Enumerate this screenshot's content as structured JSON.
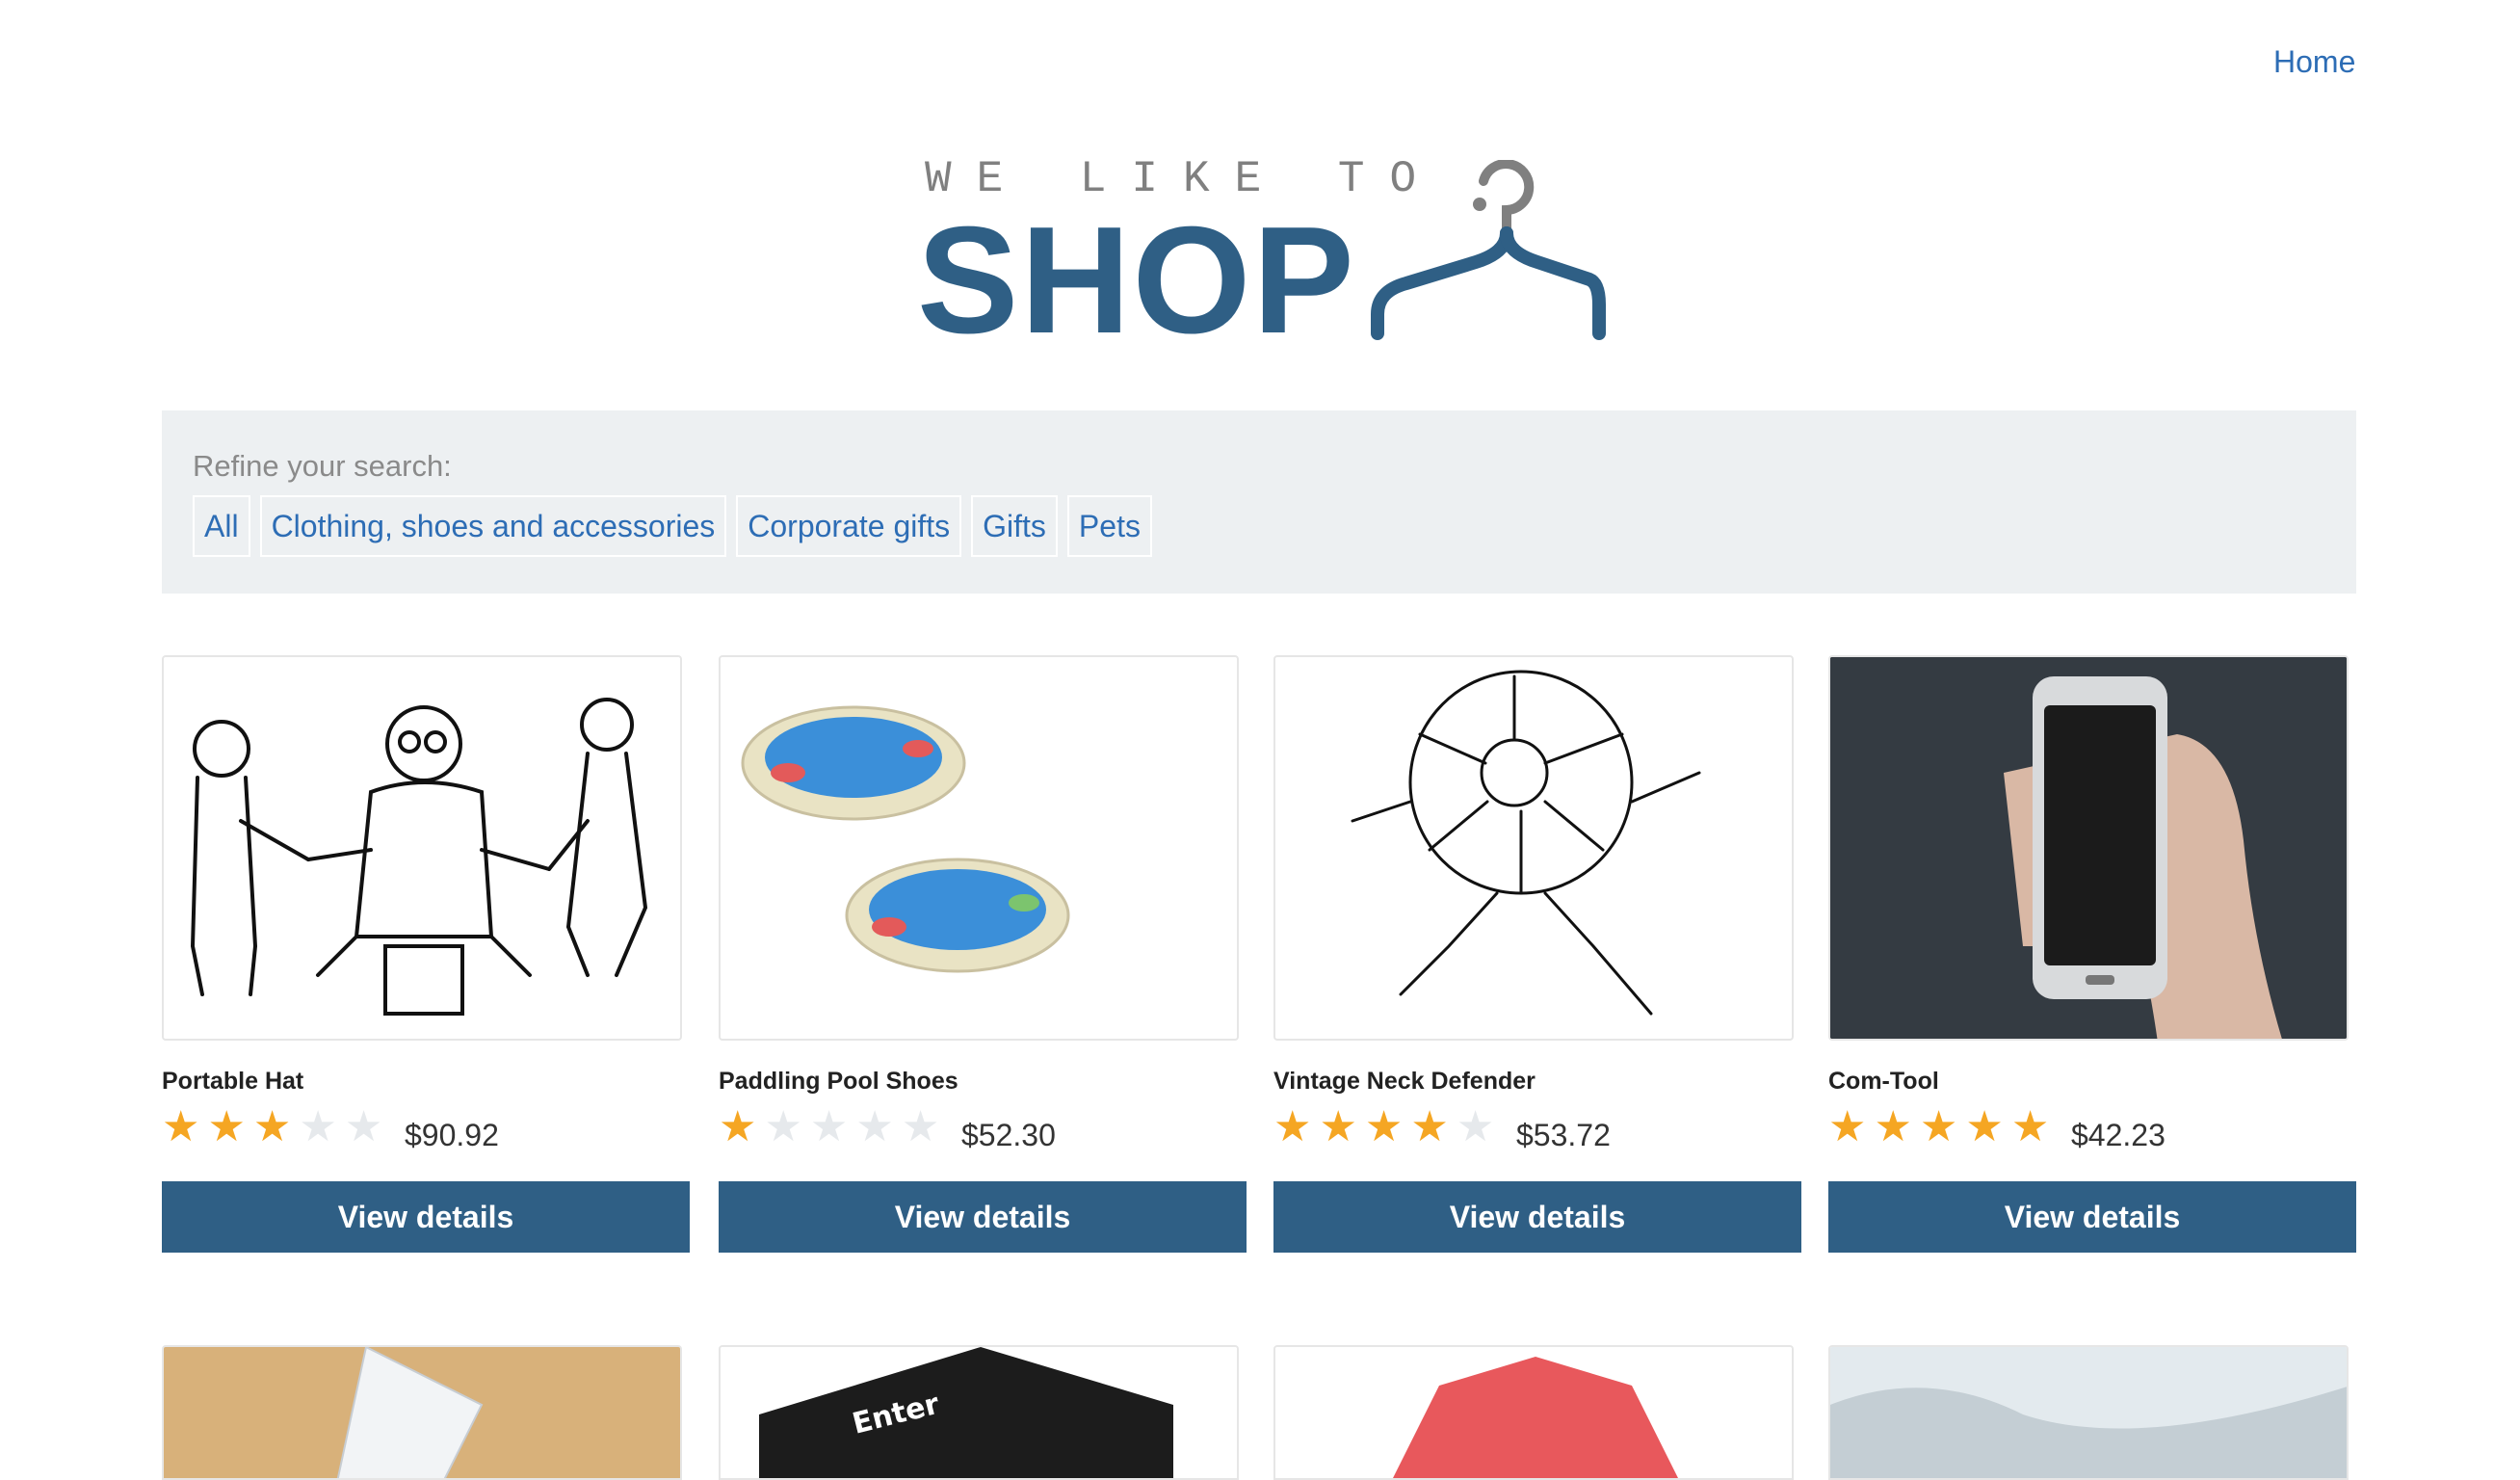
{
  "header": {
    "home_label": "Home"
  },
  "logo": {
    "small": "WE LIKE TO",
    "big": "SHOP"
  },
  "filters": {
    "label": "Refine your search:",
    "items": [
      "All",
      "Clothing, shoes and accessories",
      "Corporate gifts",
      "Gifts",
      "Pets"
    ]
  },
  "products": [
    {
      "name": "Portable Hat",
      "rating": 3,
      "max_rating": 5,
      "price": "$90.92",
      "button": "View details"
    },
    {
      "name": "Paddling Pool Shoes",
      "rating": 1,
      "max_rating": 5,
      "price": "$52.30",
      "button": "View details"
    },
    {
      "name": "Vintage Neck Defender",
      "rating": 4,
      "max_rating": 5,
      "price": "$53.72",
      "button": "View details"
    },
    {
      "name": "Com-Tool",
      "rating": 5,
      "max_rating": 5,
      "price": "$42.23",
      "button": "View details"
    }
  ],
  "colors": {
    "brand": "#2f5f85",
    "link": "#2d6db5",
    "star": "#f5a623",
    "filter_bg": "#edf0f2"
  }
}
